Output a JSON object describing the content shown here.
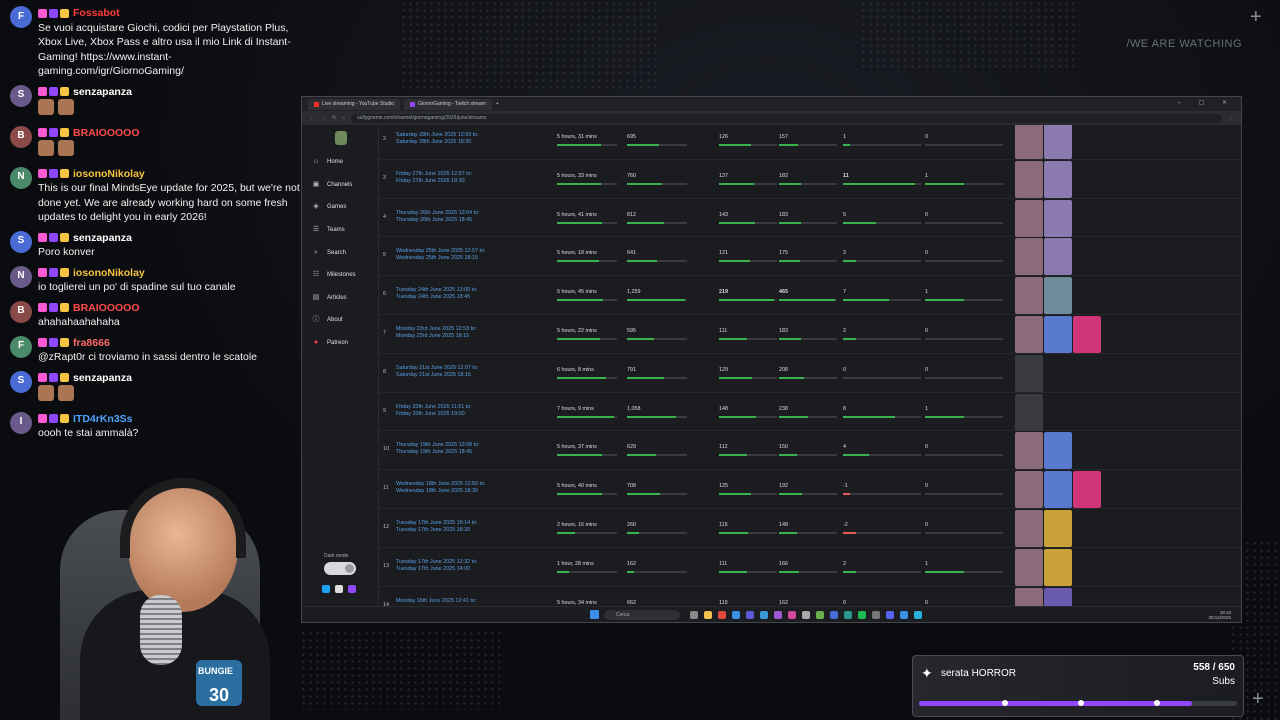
{
  "overlay": {
    "watch_text": "/WE ARE WATCHING"
  },
  "chat": [
    {
      "user": "Fossabot",
      "color": "#ff3b3b",
      "avatar": "F",
      "text": "Se vuoi acquistare Giochi, codici per Playstation Plus, Xbox Live, Xbox Pass e altro usa il mio Link di Instant-Gaming! https://www.instant-gaming.com/igr/GiornoGaming/"
    },
    {
      "user": "senzapanza",
      "color": "#ffffff",
      "avatar": "S",
      "text": ""
    },
    {
      "user": "BRAIOOOOO",
      "color": "#ff4a4a",
      "avatar": "B",
      "text": ""
    },
    {
      "user": "iosonoNikolay",
      "color": "#f6c343",
      "avatar": "N",
      "text": "This is our final MindsEye update for 2025, but we're not done yet. We are already working hard on some fresh updates to delight you in early 2026!"
    },
    {
      "user": "senzapanza",
      "color": "#ffffff",
      "avatar": "S",
      "text": "Poro konver"
    },
    {
      "user": "iosonoNikolay",
      "color": "#f6c343",
      "avatar": "N",
      "text": "io toglierei un po' di spadine sul tuo canale"
    },
    {
      "user": "BRAIOOOOO",
      "color": "#ff4a4a",
      "avatar": "B",
      "text": "ahahahaahahaha"
    },
    {
      "user": "fra8666",
      "color": "#ff6b6b",
      "avatar": "F",
      "text": "@zRapt0r ci troviamo in sassi dentro le scatole"
    },
    {
      "user": "senzapanza",
      "color": "#ffffff",
      "avatar": "S",
      "text": ""
    },
    {
      "user": "ITD4rKn3Ss",
      "color": "#4fa3ff",
      "avatar": "I",
      "text": "oooh te stai ammalà?"
    }
  ],
  "webcam": {
    "patch_text": "30",
    "brand": "BUNGIE"
  },
  "browser": {
    "tabs": [
      "Live streaming - YouTube Studio",
      "GiornoGaming - Twitch stream"
    ],
    "url": "sullygnome.com/channel/giornogaming/2025/june/streams"
  },
  "sidebar": {
    "items": [
      {
        "label": "Home",
        "icon": "home-icon",
        "glyph": "⌂"
      },
      {
        "label": "Channels",
        "icon": "channels-icon",
        "glyph": "▣"
      },
      {
        "label": "Games",
        "icon": "games-icon",
        "glyph": "◈"
      },
      {
        "label": "Teams",
        "icon": "teams-icon",
        "glyph": "☰"
      },
      {
        "label": "Search",
        "icon": "search-icon",
        "glyph": "⌕"
      },
      {
        "label": "Milestones",
        "icon": "milestones-icon",
        "glyph": "☷"
      },
      {
        "label": "Articles",
        "icon": "articles-icon",
        "glyph": "▤"
      },
      {
        "label": "About",
        "icon": "about-icon",
        "glyph": "ⓘ"
      },
      {
        "label": "Patreon",
        "icon": "patreon-icon",
        "glyph": "●"
      }
    ],
    "dark_mode_label": "Dark mode"
  },
  "streams": [
    {
      "n": "2",
      "start": "Saturday 28th June 2025 12:59 to:",
      "end": "Saturday 28th June 2025 18:30",
      "duration": "5 hours, 31 mins",
      "peak": "695",
      "avg": "126",
      "hours": "157",
      "followers": "1",
      "views": "0",
      "thumbs": [
        "#8b6b7a",
        "#8a7ab0"
      ]
    },
    {
      "n": "3",
      "start": "Friday 27th June 2025 12:57 to:",
      "end": "Friday 27th June 2025 18:30",
      "duration": "5 hours, 33 mins",
      "peak": "760",
      "avg": "137",
      "hours": "182",
      "followers": "11",
      "views": "1",
      "thumbs": [
        "#8b6b7a",
        "#8a7ab0"
      ]
    },
    {
      "n": "4",
      "start": "Thursday 26th June 2025 13:04 to:",
      "end": "Thursday 26th June 2025 18:45",
      "duration": "5 hours, 41 mins",
      "peak": "812",
      "avg": "143",
      "hours": "183",
      "followers": "5",
      "views": "0",
      "thumbs": [
        "#8b6b7a",
        "#8a7ab0"
      ]
    },
    {
      "n": "5",
      "start": "Wednesday 25th June 2025 12:57 to:",
      "end": "Wednesday 25th June 2025 18:15",
      "duration": "5 hours, 18 mins",
      "peak": "641",
      "avg": "121",
      "hours": "175",
      "followers": "2",
      "views": "0",
      "thumbs": [
        "#8b6b7a",
        "#8a7ab0"
      ]
    },
    {
      "n": "6",
      "start": "Tuesday 24th June 2025 13:00 to:",
      "end": "Tuesday 24th June 2025 18:45",
      "duration": "5 hours, 45 mins",
      "peak": "1,259",
      "avg": "219",
      "hours": "465",
      "followers": "7",
      "views": "1",
      "thumbs": [
        "#8b6b7a",
        "#6f8a9a"
      ]
    },
    {
      "n": "7",
      "start": "Monday 23rd June 2025 12:53 to:",
      "end": "Monday 23rd June 2025 18:15",
      "duration": "5 hours, 22 mins",
      "peak": "595",
      "avg": "111",
      "hours": "183",
      "followers": "2",
      "views": "0",
      "thumbs": [
        "#8b6b7a",
        "#5a7ad0",
        "#d0357a"
      ]
    },
    {
      "n": "8",
      "start": "Saturday 21st June 2025 12:07 to:",
      "end": "Saturday 21st June 2025 18:15",
      "duration": "6 hours, 8 mins",
      "peak": "791",
      "avg": "129",
      "hours": "208",
      "followers": "0",
      "views": "0",
      "thumbs": [
        "#3a3b40"
      ]
    },
    {
      "n": "9",
      "start": "Friday 20th June 2025 11:51 to:",
      "end": "Friday 20th June 2025 19:00",
      "duration": "7 hours, 9 mins",
      "peak": "1,058",
      "avg": "148",
      "hours": "238",
      "followers": "8",
      "views": "1",
      "thumbs": [
        "#3a3b40"
      ]
    },
    {
      "n": "10",
      "start": "Thursday 19th June 2025 13:08 to:",
      "end": "Thursday 19th June 2025 18:45",
      "duration": "5 hours, 37 mins",
      "peak": "629",
      "avg": "112",
      "hours": "150",
      "followers": "4",
      "views": "0",
      "thumbs": [
        "#8b6b7a",
        "#5a7ad0"
      ]
    },
    {
      "n": "11",
      "start": "Wednesday 18th June 2025 12:50 to:",
      "end": "Wednesday 18th June 2025 18:30",
      "duration": "5 hours, 40 mins",
      "peak": "708",
      "avg": "125",
      "hours": "192",
      "followers": "-1",
      "views": "0",
      "thumbs": [
        "#8b6b7a",
        "#5a7ad0",
        "#d0357a"
      ]
    },
    {
      "n": "12",
      "start": "Tuesday 17th June 2025 16:14 to:",
      "end": "Tuesday 17th June 2025 18:30",
      "duration": "2 hours, 16 mins",
      "peak": "260",
      "avg": "115",
      "hours": "148",
      "followers": "-2",
      "views": "0",
      "thumbs": [
        "#8b6b7a",
        "#c9a23a"
      ]
    },
    {
      "n": "13",
      "start": "Tuesday 17th June 2025 12:32 to:",
      "end": "Tuesday 17th June 2025 14:00",
      "duration": "1 hour, 28 mins",
      "peak": "162",
      "avg": "111",
      "hours": "166",
      "followers": "2",
      "views": "1",
      "thumbs": [
        "#8b6b7a",
        "#c9a23a"
      ]
    },
    {
      "n": "14",
      "start": "Monday 16th June 2025 12:41 to:",
      "end": "",
      "duration": "5 hours, 34 mins",
      "peak": "662",
      "avg": "119",
      "hours": "162",
      "followers": "0",
      "views": "0",
      "thumbs": [
        "#8b6b7a",
        "#6a5ab0"
      ]
    }
  ],
  "taskbar": {
    "search_placeholder": "Cerca",
    "time": "18:18",
    "date": "30/12/2025"
  },
  "sub_goal": {
    "title": "serata HORROR",
    "count": "558 / 650",
    "unit": "Subs",
    "progress": 0.858
  }
}
